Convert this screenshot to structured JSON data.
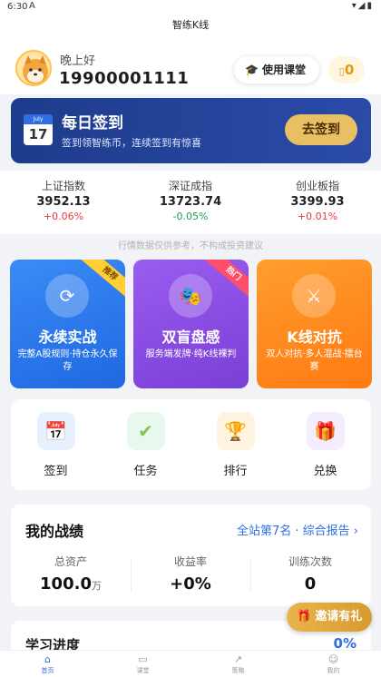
{
  "status_bar": {
    "time": "6:30",
    "download": "A"
  },
  "app_title": "智练K线",
  "header": {
    "greeting": "晚上好",
    "phone": "19900001111",
    "course_label": "使用课堂",
    "coins": "0"
  },
  "signin": {
    "cal_month": "July",
    "cal_day": "17",
    "title": "每日签到",
    "subtitle": "签到领智练币，连续签到有惊喜",
    "button": "去签到"
  },
  "market": [
    {
      "name": "上证指数",
      "value": "3952.13",
      "change": "+0.06%",
      "color": "#e23c3c"
    },
    {
      "name": "深证成指",
      "value": "13723.74",
      "change": "-0.05%",
      "color": "#19a15a"
    },
    {
      "name": "创业板指",
      "value": "3399.93",
      "change": "+0.01%",
      "color": "#e23c3c"
    }
  ],
  "disclaimer": "行情数据仅供参考，不构成投资建议",
  "modes": [
    {
      "title": "永续实战",
      "desc": "完整A股规则·持仓永久保存",
      "badge": "推荐",
      "color": "#2f7ff0"
    },
    {
      "title": "双盲盘感",
      "desc": "服务端发牌·纯K线裸判",
      "badge": "热门",
      "color": "#8a4fe0"
    },
    {
      "title": "K线对抗",
      "desc": "双人对抗·多人混战·擂台赛",
      "badge": "",
      "color": "#ff8a1f"
    }
  ],
  "quick": [
    {
      "label": "签到",
      "icon": "calendar-icon"
    },
    {
      "label": "任务",
      "icon": "check-icon"
    },
    {
      "label": "排行",
      "icon": "trophy-icon"
    },
    {
      "label": "兑换",
      "icon": "gift-icon"
    }
  ],
  "stats": {
    "title": "我的战绩",
    "link": "全站第7名 · 综合报告 ›",
    "items": [
      {
        "label": "总资产",
        "value": "100.0",
        "unit": "万"
      },
      {
        "label": "收益率",
        "value": "+0%",
        "unit": ""
      },
      {
        "label": "训练次数",
        "value": "0",
        "unit": ""
      }
    ]
  },
  "progress": {
    "title": "学习进度",
    "percent": "0%"
  },
  "invite": "邀请有礼",
  "tabs": [
    {
      "label": "首页",
      "active": true
    },
    {
      "label": "课堂",
      "active": false
    },
    {
      "label": "策略",
      "active": false
    },
    {
      "label": "我的",
      "active": false
    }
  ]
}
